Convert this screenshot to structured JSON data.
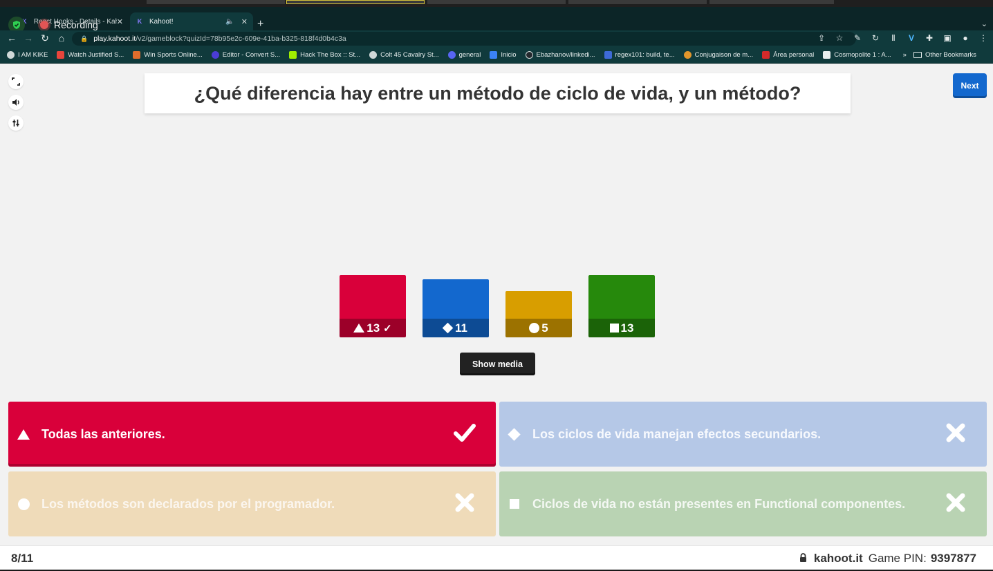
{
  "browser": {
    "tabs": [
      {
        "title": "React Hooks - Details - Kahoot!",
        "active": false
      },
      {
        "title": "Kahoot!",
        "active": true
      }
    ],
    "recording_label": "Recording",
    "url_host": "play.kahoot.it",
    "url_path": "/v2/gameblock?quizId=78b95e2c-609e-41ba-b325-818f4d0b4c3a",
    "bookmarks": [
      {
        "label": "I AM KIKE",
        "color": "#cfd8d8"
      },
      {
        "label": "Watch Justified S...",
        "color": "#e8453c"
      },
      {
        "label": "Win Sports Online...",
        "color": "#e06d2c"
      },
      {
        "label": "Editor - Convert S...",
        "color": "#4b3cd6"
      },
      {
        "label": "Hack The Box :: St...",
        "color": "#9fef00"
      },
      {
        "label": "Colt 45 Cavalry St...",
        "color": "#cfd8d8"
      },
      {
        "label": "general",
        "color": "#5865f2"
      },
      {
        "label": "Inicio",
        "color": "#3b82f6"
      },
      {
        "label": "Ebazhanov/linkedi...",
        "color": "#24292e"
      },
      {
        "label": "regex101: build, te...",
        "color": "#3e6ad6"
      },
      {
        "label": "Conjugaison de m...",
        "color": "#e2962c"
      },
      {
        "label": "Área personal",
        "color": "#d42a2a"
      },
      {
        "label": "Cosmopolite 1 : A...",
        "color": "#e8eeee"
      }
    ],
    "bookmarks_overflow": "»",
    "other_bookmarks": "Other Bookmarks"
  },
  "game": {
    "question": "¿Qué diferencia hay entre un método de ciclo de vida, y un método?",
    "next_label": "Next",
    "show_media_label": "Show media",
    "answers": [
      {
        "shape": "triangle",
        "text": "Todas las anteriores.",
        "correct": true,
        "color": "#d9003a"
      },
      {
        "shape": "diamond",
        "text": "Los ciclos de vida manejan efectos secundarios.",
        "correct": false,
        "color": "#1368ce"
      },
      {
        "shape": "circle",
        "text": "Los métodos son declarados por el programador.",
        "correct": false,
        "color": "#d89e00"
      },
      {
        "shape": "square",
        "text": "Ciclos de vida no están presentes en Functional componentes.",
        "correct": false,
        "color": "#26890c"
      }
    ],
    "progress": "8/11",
    "brand": "kahoot.it",
    "pin_label": "Game PIN:",
    "pin": "9397877"
  },
  "chart_data": {
    "type": "bar",
    "categories": [
      "triangle",
      "diamond",
      "circle",
      "square"
    ],
    "values": [
      13,
      11,
      5,
      13
    ],
    "colors": [
      "#d9003a",
      "#1368ce",
      "#d89e00",
      "#26890c"
    ],
    "correct": [
      true,
      false,
      false,
      false
    ]
  }
}
